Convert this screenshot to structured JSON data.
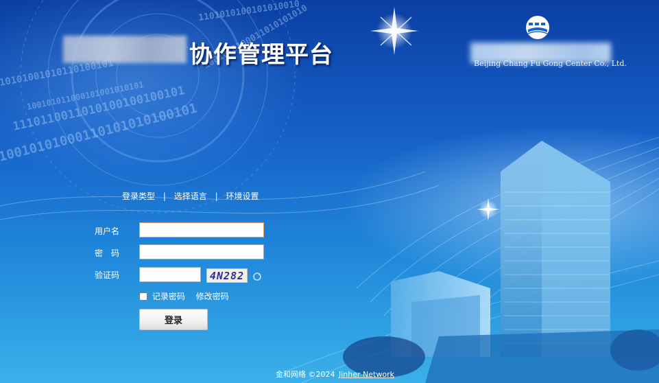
{
  "header": {
    "title": "协作管理平台",
    "company_en": "Beijing Chang Fu Gong Center Co., Ltd.",
    "logo_icon": "company-logo-icon"
  },
  "background": {
    "binary_rows": [
      "1101010100101010010",
      "10101001010110100101",
      "1110110011010100100100101",
      "10010101000110101010100101",
      "100101011000101001010101",
      "1001010100011010101010"
    ]
  },
  "top_menu": {
    "login_type": "登录类型",
    "language": "选择语言",
    "environment": "环境设置",
    "separator": "|"
  },
  "form": {
    "username_label": "用户名",
    "username_value": "",
    "password_label": "密　码",
    "password_value": "",
    "captcha_label": "验证码",
    "captcha_value": "",
    "captcha_text": "4N282",
    "remember_label": "记录密码",
    "change_password": "修改密码",
    "login_button": "登录"
  },
  "footer": {
    "copyright": "金和网络 ©2024",
    "link_text": "Jinher Network"
  },
  "colors": {
    "bg_top": "#0b3fa3",
    "bg_bottom": "#3ab1ea",
    "text": "#ffffff",
    "input_border": "#9aa9bf"
  }
}
